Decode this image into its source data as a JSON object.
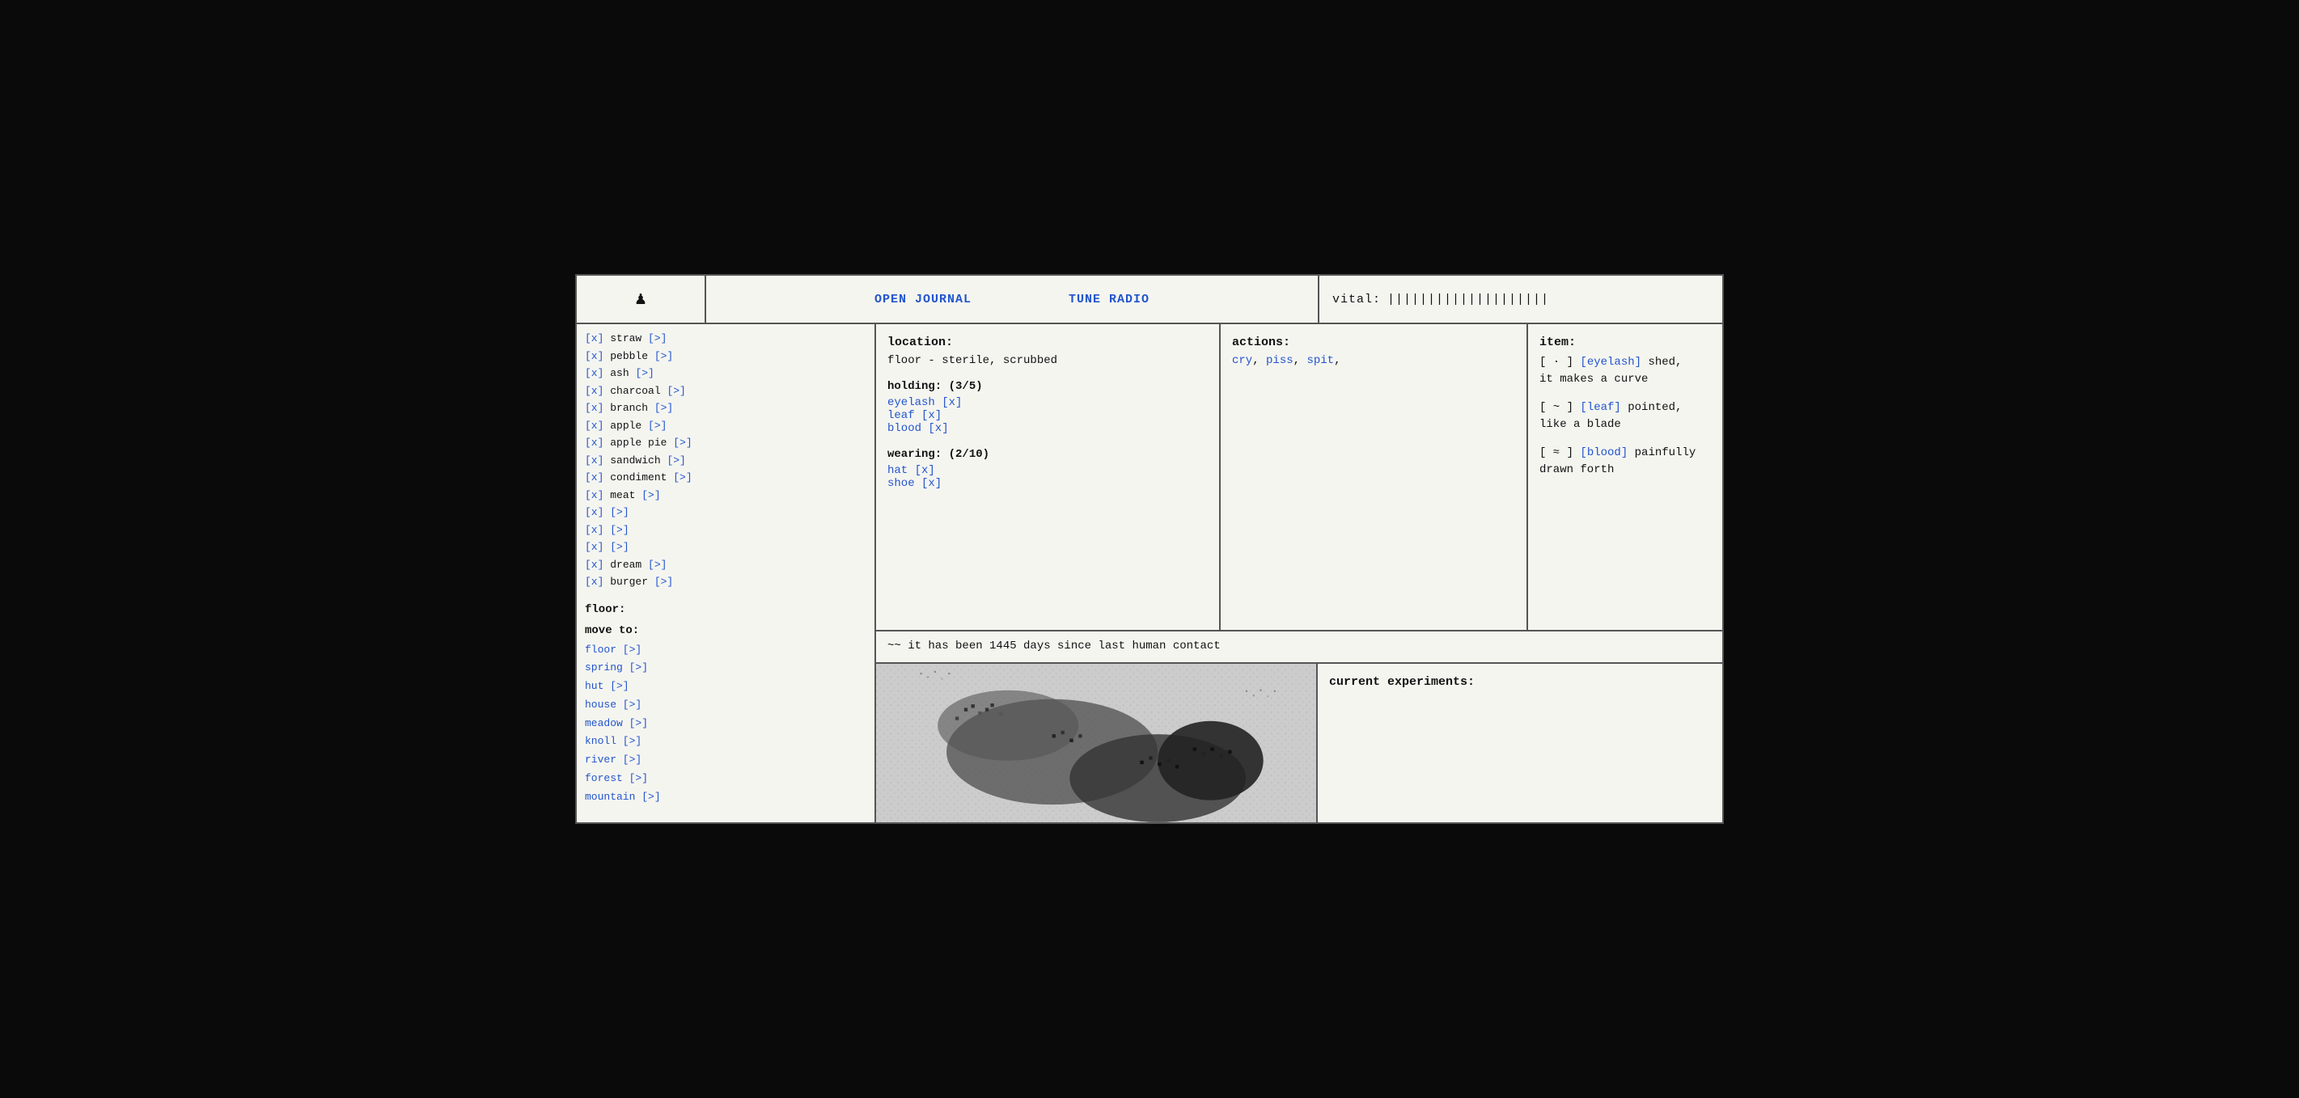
{
  "topbar": {
    "icon": "♟",
    "journal_label": "OPEN JOURNAL",
    "radio_label": "TUNE RADIO",
    "vital_label": "vital:",
    "vital_bars": "||||||||||||||||||||"
  },
  "inventory": {
    "items": [
      {
        "marker": "[x]",
        "name": "straw",
        "link": "[>]"
      },
      {
        "marker": "[x]",
        "name": "pebble",
        "link": "[>]"
      },
      {
        "marker": "[x]",
        "name": "ash",
        "link": "[>]"
      },
      {
        "marker": "[x]",
        "name": "charcoal",
        "link": "[>]"
      },
      {
        "marker": "[x]",
        "name": "branch",
        "link": "[>]"
      },
      {
        "marker": "[x]",
        "name": "apple",
        "link": "[>]"
      },
      {
        "marker": "[x]",
        "name": "apple pie",
        "link": "[>]"
      },
      {
        "marker": "[x]",
        "name": "sandwich",
        "link": "[>]"
      },
      {
        "marker": "[x]",
        "name": "condiment",
        "link": "[>]"
      },
      {
        "marker": "[x]",
        "name": "meat",
        "link": "[>]"
      },
      {
        "marker": "[x]",
        "name": "",
        "link": "[>]"
      },
      {
        "marker": "[x]",
        "name": "",
        "link": "[>]"
      },
      {
        "marker": "[x]",
        "name": "",
        "link": "[>]"
      },
      {
        "marker": "[x]",
        "name": "dream",
        "link": "[>]"
      },
      {
        "marker": "[x]",
        "name": "burger",
        "link": "[>]"
      }
    ],
    "floor_label": "floor:",
    "move_label": "move to:",
    "locations": [
      {
        "name": "floor",
        "link": "[>]"
      },
      {
        "name": "spring",
        "link": "[>]"
      },
      {
        "name": "hut",
        "link": "[>]"
      },
      {
        "name": "house",
        "link": "[>]"
      },
      {
        "name": "meadow",
        "link": "[>]"
      },
      {
        "name": "knoll",
        "link": "[>]"
      },
      {
        "name": "river",
        "link": "[>]"
      },
      {
        "name": "forest",
        "link": "[>]"
      },
      {
        "name": "mountain",
        "link": "[>]"
      }
    ]
  },
  "location": {
    "label": "location:",
    "description": "floor - sterile, scrubbed",
    "holding_label": "holding:",
    "holding_count": "(3/5)",
    "holding_items": [
      {
        "name": "eyelash",
        "marker": "[x]"
      },
      {
        "name": "leaf",
        "marker": "[x]"
      },
      {
        "name": "blood",
        "marker": "[x]"
      }
    ],
    "wearing_label": "wearing:",
    "wearing_count": "(2/10)",
    "wearing_items": [
      {
        "name": "hat",
        "marker": "[x]"
      },
      {
        "name": "shoe",
        "marker": "[x]"
      }
    ]
  },
  "actions": {
    "label": "actions:",
    "items": [
      "cry",
      "piss",
      "spit"
    ]
  },
  "item": {
    "label": "item:",
    "entries": [
      {
        "marker": "[ · ]",
        "name": "[eyelash]",
        "description": "shed, it makes a curve"
      },
      {
        "marker": "[ ~ ]",
        "name": "[leaf]",
        "description": "pointed, like a blade"
      },
      {
        "marker": "[ ≈ ]",
        "name": "[blood]",
        "description": "painfully drawn forth"
      }
    ]
  },
  "message": {
    "text": "~~ it has been 1445 days since last human contact"
  },
  "experiments": {
    "label": "current experiments:"
  }
}
